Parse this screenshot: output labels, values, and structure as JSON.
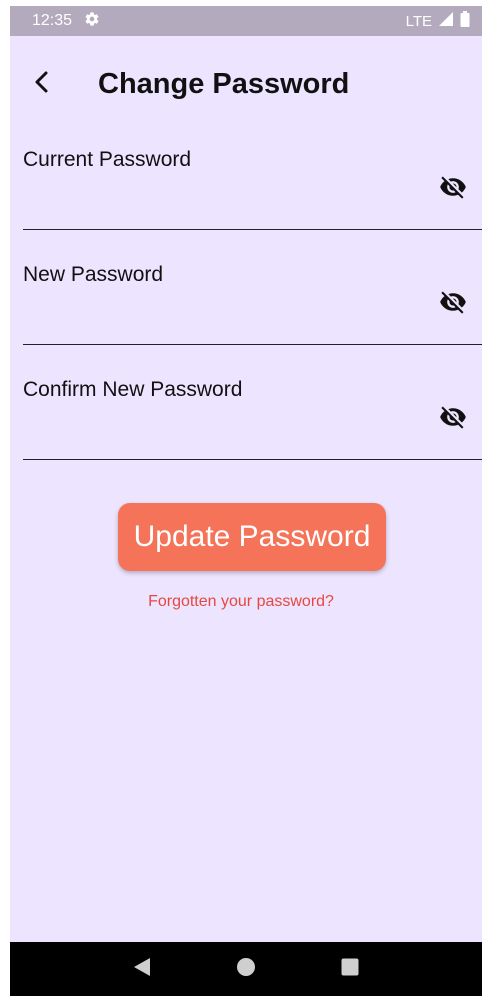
{
  "status_bar": {
    "time": "12:35",
    "network": "LTE",
    "icons": [
      "settings-icon",
      "signal-icon",
      "battery-icon"
    ]
  },
  "appbar": {
    "title": "Change Password",
    "back_icon": "chevron-left-icon"
  },
  "form": {
    "fields": [
      {
        "label": "Current Password",
        "value": "",
        "icon": "eye-off-icon"
      },
      {
        "label": "New Password",
        "value": "",
        "icon": "eye-off-icon"
      },
      {
        "label": "Confirm New Password",
        "value": "",
        "icon": "eye-off-icon"
      }
    ]
  },
  "actions": {
    "update_label": "Update Password",
    "forgot_label": "Forgotten your password?"
  },
  "nav": {
    "icons": [
      "back-triangle-icon",
      "home-circle-icon",
      "recents-square-icon"
    ]
  },
  "colors": {
    "background": "#ede4ff",
    "status_bar": "#b3abbd",
    "button": "#f57359",
    "link": "#e64840"
  }
}
